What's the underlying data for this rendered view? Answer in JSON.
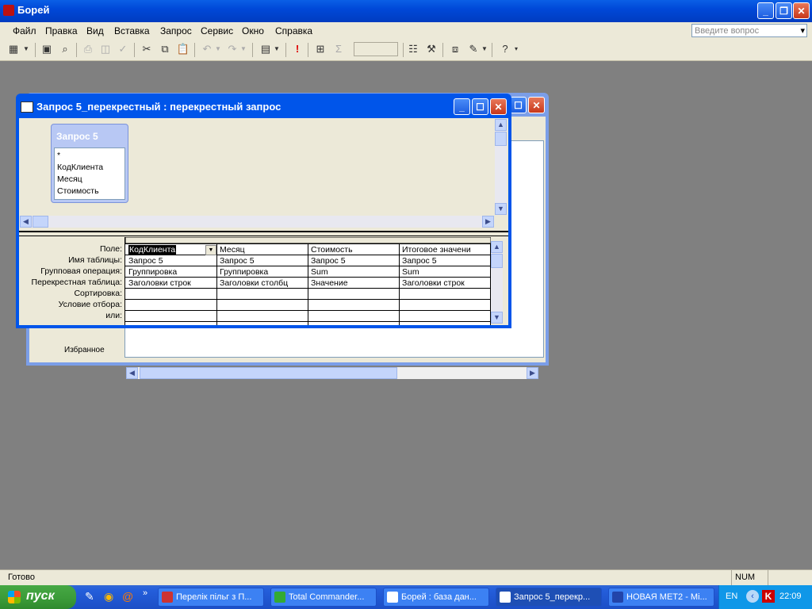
{
  "app": {
    "title": "Борей"
  },
  "menu": {
    "items": [
      "Файл",
      "Правка",
      "Вид",
      "Вставка",
      "Запрос",
      "Сервис",
      "Окно",
      "Справка"
    ],
    "ask_placeholder": "Введите вопрос"
  },
  "query_window": {
    "title": "Запрос 5_перекрестный : перекрестный запрос",
    "field_list": {
      "title": "Запрос 5",
      "fields": [
        "*",
        "КодКлиента",
        "Месяц",
        "Стоимость"
      ]
    },
    "grid": {
      "row_labels": [
        "Поле:",
        "Имя таблицы:",
        "Групповая операция:",
        "Перекрестная таблица:",
        "Сортировка:",
        "Условие отбора:",
        "или:"
      ],
      "columns": [
        {
          "field": "КодКлиента",
          "table": "Запрос 5",
          "group": "Группировка",
          "crosstab": "Заголовки строк"
        },
        {
          "field": "Месяц",
          "table": "Запрос 5",
          "group": "Группировка",
          "crosstab": "Заголовки столбц"
        },
        {
          "field": "Стоимость",
          "table": "Запрос 5",
          "group": "Sum",
          "crosstab": "Значение"
        },
        {
          "field": "Итоговое значени",
          "table": "Запрос 5",
          "group": "Sum",
          "crosstab": "Заголовки строк"
        }
      ]
    }
  },
  "background_window": {
    "partial_text": "Избранное"
  },
  "status": {
    "left": "Готово",
    "num": "NUM"
  },
  "taskbar": {
    "start_label": "пуск",
    "tasks": [
      "Перелік пільг з П...",
      "Total Commander...",
      "Борей : база дан...",
      "Запрос 5_перекр...",
      "НОВАЯ МЕТ2 - Mi..."
    ],
    "lang": "EN",
    "clock": "22:09"
  }
}
